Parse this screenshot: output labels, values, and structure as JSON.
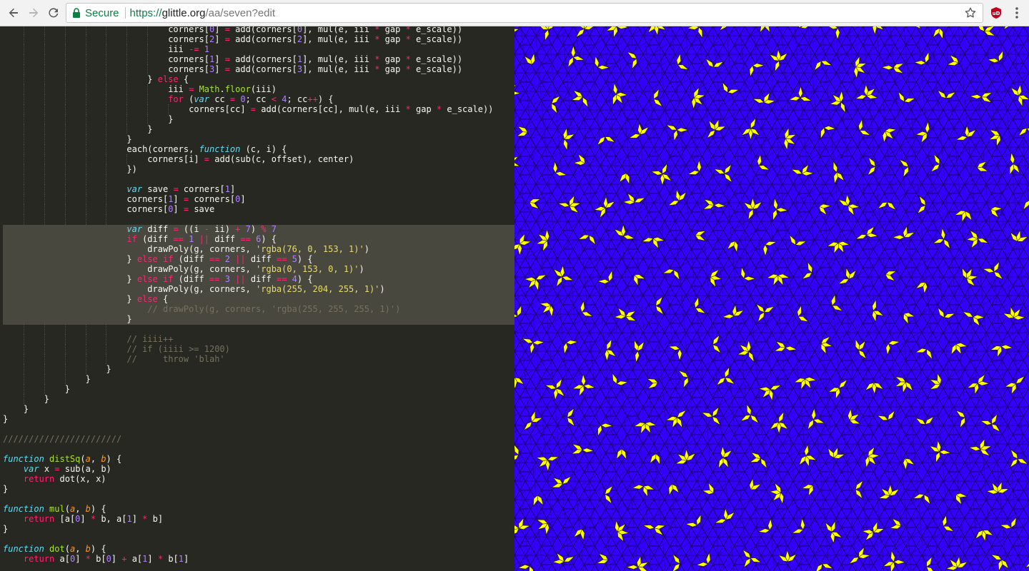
{
  "browser": {
    "secure_label": "Secure",
    "url_scheme": "https://",
    "url_host": "glittle.org",
    "url_path": "/aa/seven?edit",
    "extension_badge": "uD",
    "icons": [
      "back-icon",
      "forward-icon",
      "reload-icon",
      "lock-icon",
      "star-icon",
      "extension-icon",
      "menu-icon"
    ]
  },
  "colors": {
    "editor_bg": "#272822",
    "highlight_bg": "#49483e",
    "canvas_blue": "#3300ff",
    "canvas_yellow": "#ffff00",
    "secure_green": "#0b8043"
  },
  "editor": {
    "lines": [
      [
        [
          32,
          ""
        ],
        [
          "p",
          "corners["
        ],
        [
          "n",
          "0"
        ],
        [
          "p",
          "] "
        ],
        [
          "k",
          "="
        ],
        [
          "p",
          " add(corners["
        ],
        [
          "n",
          "0"
        ],
        [
          "p",
          "], mul(e, iii "
        ],
        [
          "k",
          "*"
        ],
        [
          "p",
          " gap "
        ],
        [
          "k",
          "*"
        ],
        [
          "p",
          " e_scale))"
        ]
      ],
      [
        [
          32,
          ""
        ],
        [
          "p",
          "corners["
        ],
        [
          "n",
          "2"
        ],
        [
          "p",
          "] "
        ],
        [
          "k",
          "="
        ],
        [
          "p",
          " add(corners["
        ],
        [
          "n",
          "2"
        ],
        [
          "p",
          "], mul(e, iii "
        ],
        [
          "k",
          "*"
        ],
        [
          "p",
          " gap "
        ],
        [
          "k",
          "*"
        ],
        [
          "p",
          " e_scale))"
        ]
      ],
      [
        [
          32,
          ""
        ],
        [
          "p",
          "iii "
        ],
        [
          "k",
          "-="
        ],
        [
          "p",
          " "
        ],
        [
          "n",
          "1"
        ]
      ],
      [
        [
          32,
          ""
        ],
        [
          "p",
          "corners["
        ],
        [
          "n",
          "1"
        ],
        [
          "p",
          "] "
        ],
        [
          "k",
          "="
        ],
        [
          "p",
          " add(corners["
        ],
        [
          "n",
          "1"
        ],
        [
          "p",
          "], mul(e, iii "
        ],
        [
          "k",
          "*"
        ],
        [
          "p",
          " gap "
        ],
        [
          "k",
          "*"
        ],
        [
          "p",
          " e_scale))"
        ]
      ],
      [
        [
          32,
          ""
        ],
        [
          "p",
          "corners["
        ],
        [
          "n",
          "3"
        ],
        [
          "p",
          "] "
        ],
        [
          "k",
          "="
        ],
        [
          "p",
          " add(corners["
        ],
        [
          "n",
          "3"
        ],
        [
          "p",
          "], mul(e, iii "
        ],
        [
          "k",
          "*"
        ],
        [
          "p",
          " gap "
        ],
        [
          "k",
          "*"
        ],
        [
          "p",
          " e_scale))"
        ]
      ],
      [
        [
          28,
          ""
        ],
        [
          "p",
          "} "
        ],
        [
          "k",
          "else"
        ],
        [
          "p",
          " {"
        ]
      ],
      [
        [
          32,
          ""
        ],
        [
          "p",
          "iii "
        ],
        [
          "k",
          "="
        ],
        [
          "p",
          " "
        ],
        [
          "b",
          "Math"
        ],
        [
          "p",
          "."
        ],
        [
          "f",
          "floor"
        ],
        [
          "p",
          "(iii)"
        ]
      ],
      [
        [
          32,
          ""
        ],
        [
          "k",
          "for"
        ],
        [
          "p",
          " ("
        ],
        [
          "s",
          "var"
        ],
        [
          "p",
          " cc "
        ],
        [
          "k",
          "="
        ],
        [
          "p",
          " "
        ],
        [
          "n",
          "0"
        ],
        [
          "p",
          "; cc "
        ],
        [
          "k",
          "<"
        ],
        [
          "p",
          " "
        ],
        [
          "n",
          "4"
        ],
        [
          "p",
          "; cc"
        ],
        [
          "k",
          "++"
        ],
        [
          "p",
          ") {"
        ]
      ],
      [
        [
          36,
          ""
        ],
        [
          "p",
          "corners[cc] "
        ],
        [
          "k",
          "="
        ],
        [
          "p",
          " add(corners[cc], mul(e, iii "
        ],
        [
          "k",
          "*"
        ],
        [
          "p",
          " gap "
        ],
        [
          "k",
          "*"
        ],
        [
          "p",
          " e_scale))"
        ]
      ],
      [
        [
          32,
          ""
        ],
        [
          "p",
          "}"
        ]
      ],
      [
        [
          28,
          ""
        ],
        [
          "p",
          "}"
        ]
      ],
      [
        [
          24,
          ""
        ],
        [
          "p",
          "}"
        ]
      ],
      [
        [
          24,
          ""
        ],
        [
          "p",
          "each(corners, "
        ],
        [
          "s",
          "function"
        ],
        [
          "p",
          " (c, i) {"
        ]
      ],
      [
        [
          28,
          ""
        ],
        [
          "p",
          "corners[i] "
        ],
        [
          "k",
          "="
        ],
        [
          "p",
          " add(sub(c, offset), center)"
        ]
      ],
      [
        [
          24,
          ""
        ],
        [
          "p",
          "})"
        ]
      ],
      [
        [
          24,
          ""
        ]
      ],
      [
        [
          24,
          ""
        ],
        [
          "s",
          "var"
        ],
        [
          "p",
          " save "
        ],
        [
          "k",
          "="
        ],
        [
          "p",
          " corners["
        ],
        [
          "n",
          "1"
        ],
        [
          "p",
          "]"
        ]
      ],
      [
        [
          24,
          ""
        ],
        [
          "p",
          "corners["
        ],
        [
          "n",
          "1"
        ],
        [
          "p",
          "] "
        ],
        [
          "k",
          "="
        ],
        [
          "p",
          " corners["
        ],
        [
          "n",
          "0"
        ],
        [
          "p",
          "]"
        ]
      ],
      [
        [
          24,
          ""
        ],
        [
          "p",
          "corners["
        ],
        [
          "n",
          "0"
        ],
        [
          "p",
          "] "
        ],
        [
          "k",
          "="
        ],
        [
          "p",
          " save"
        ]
      ],
      [
        [
          24,
          ""
        ]
      ],
      [
        [
          24,
          ""
        ],
        [
          "s",
          "var"
        ],
        [
          "p",
          " diff "
        ],
        [
          "k",
          "="
        ],
        [
          "p",
          " ((i "
        ],
        [
          "k",
          "-"
        ],
        [
          "p",
          " ii) "
        ],
        [
          "k",
          "+"
        ],
        [
          "p",
          " "
        ],
        [
          "n",
          "7"
        ],
        [
          "p",
          ") "
        ],
        [
          "k",
          "%"
        ],
        [
          "p",
          " "
        ],
        [
          "n",
          "7"
        ]
      ],
      [
        [
          24,
          ""
        ],
        [
          "k",
          "if"
        ],
        [
          "p",
          " (diff "
        ],
        [
          "k",
          "=="
        ],
        [
          "p",
          " "
        ],
        [
          "n",
          "1"
        ],
        [
          "p",
          " "
        ],
        [
          "k",
          "||"
        ],
        [
          "p",
          " diff "
        ],
        [
          "k",
          "=="
        ],
        [
          "p",
          " "
        ],
        [
          "n",
          "6"
        ],
        [
          "p",
          ") {"
        ]
      ],
      [
        [
          28,
          ""
        ],
        [
          "p",
          "drawPoly(g, corners, "
        ],
        [
          "t",
          "'rgba(76, 0, 153, 1)'"
        ],
        [
          "p",
          ")"
        ]
      ],
      [
        [
          24,
          ""
        ],
        [
          "p",
          "} "
        ],
        [
          "k",
          "else"
        ],
        [
          "p",
          " "
        ],
        [
          "k",
          "if"
        ],
        [
          "p",
          " (diff "
        ],
        [
          "k",
          "=="
        ],
        [
          "p",
          " "
        ],
        [
          "n",
          "2"
        ],
        [
          "p",
          " "
        ],
        [
          "k",
          "||"
        ],
        [
          "p",
          " diff "
        ],
        [
          "k",
          "=="
        ],
        [
          "p",
          " "
        ],
        [
          "n",
          "5"
        ],
        [
          "p",
          ") {"
        ]
      ],
      [
        [
          28,
          ""
        ],
        [
          "p",
          "drawPoly(g, corners, "
        ],
        [
          "t",
          "'rgba(0, 153, 0, 1)'"
        ],
        [
          "p",
          ")"
        ]
      ],
      [
        [
          24,
          ""
        ],
        [
          "p",
          "} "
        ],
        [
          "k",
          "else"
        ],
        [
          "p",
          " "
        ],
        [
          "k",
          "if"
        ],
        [
          "p",
          " (diff "
        ],
        [
          "k",
          "=="
        ],
        [
          "p",
          " "
        ],
        [
          "n",
          "3"
        ],
        [
          "p",
          " "
        ],
        [
          "k",
          "||"
        ],
        [
          "p",
          " diff "
        ],
        [
          "k",
          "=="
        ],
        [
          "p",
          " "
        ],
        [
          "n",
          "4"
        ],
        [
          "p",
          ") {"
        ]
      ],
      [
        [
          28,
          ""
        ],
        [
          "p",
          "drawPoly(g, corners, "
        ],
        [
          "t",
          "'rgba(255, 204, 255, 1)'"
        ],
        [
          "p",
          ")"
        ]
      ],
      [
        [
          24,
          ""
        ],
        [
          "p",
          "} "
        ],
        [
          "k",
          "else"
        ],
        [
          "p",
          " {"
        ]
      ],
      [
        [
          28,
          ""
        ],
        [
          "c",
          "// drawPoly(g, corners, 'rgba(255, 255, 255, 1)')"
        ]
      ],
      [
        [
          24,
          ""
        ],
        [
          "p",
          "}"
        ]
      ],
      [
        [
          24,
          ""
        ]
      ],
      [
        [
          24,
          ""
        ],
        [
          "c",
          "// iiii++"
        ]
      ],
      [
        [
          24,
          ""
        ],
        [
          "c",
          "// if (iiii >= 1200)"
        ]
      ],
      [
        [
          24,
          ""
        ],
        [
          "c",
          "//     throw 'blah'"
        ]
      ],
      [
        [
          20,
          ""
        ],
        [
          "p",
          "}"
        ]
      ],
      [
        [
          16,
          ""
        ],
        [
          "p",
          "}"
        ]
      ],
      [
        [
          12,
          ""
        ],
        [
          "p",
          "}"
        ]
      ],
      [
        [
          8,
          ""
        ],
        [
          "p",
          "}"
        ]
      ],
      [
        [
          4,
          ""
        ],
        [
          "p",
          "}"
        ]
      ],
      [
        [
          0,
          ""
        ],
        [
          "p",
          "}"
        ]
      ],
      [
        [
          0,
          ""
        ]
      ],
      [
        [
          0,
          ""
        ],
        [
          "c",
          "///////////////////////"
        ]
      ],
      [
        [
          0,
          ""
        ]
      ],
      [
        [
          0,
          ""
        ],
        [
          "s",
          "function"
        ],
        [
          "p",
          " "
        ],
        [
          "f",
          "distSq"
        ],
        [
          "p",
          "("
        ],
        [
          "a",
          "a"
        ],
        [
          "p",
          ", "
        ],
        [
          "a",
          "b"
        ],
        [
          "p",
          ") {"
        ]
      ],
      [
        [
          4,
          ""
        ],
        [
          "s",
          "var"
        ],
        [
          "p",
          " x "
        ],
        [
          "k",
          "="
        ],
        [
          "p",
          " sub(a, b)"
        ]
      ],
      [
        [
          4,
          ""
        ],
        [
          "k",
          "return"
        ],
        [
          "p",
          " dot(x, x)"
        ]
      ],
      [
        [
          0,
          ""
        ],
        [
          "p",
          "}"
        ]
      ],
      [
        [
          0,
          ""
        ]
      ],
      [
        [
          0,
          ""
        ],
        [
          "s",
          "function"
        ],
        [
          "p",
          " "
        ],
        [
          "f",
          "mul"
        ],
        [
          "p",
          "("
        ],
        [
          "a",
          "a"
        ],
        [
          "p",
          ", "
        ],
        [
          "a",
          "b"
        ],
        [
          "p",
          ") {"
        ]
      ],
      [
        [
          4,
          ""
        ],
        [
          "k",
          "return"
        ],
        [
          "p",
          " [a["
        ],
        [
          "n",
          "0"
        ],
        [
          "p",
          "] "
        ],
        [
          "k",
          "*"
        ],
        [
          "p",
          " b, a["
        ],
        [
          "n",
          "1"
        ],
        [
          "p",
          "] "
        ],
        [
          "k",
          "*"
        ],
        [
          "p",
          " b]"
        ]
      ],
      [
        [
          0,
          ""
        ],
        [
          "p",
          "}"
        ]
      ],
      [
        [
          0,
          ""
        ]
      ],
      [
        [
          0,
          ""
        ],
        [
          "s",
          "function"
        ],
        [
          "p",
          " "
        ],
        [
          "f",
          "dot"
        ],
        [
          "p",
          "("
        ],
        [
          "a",
          "a"
        ],
        [
          "p",
          ", "
        ],
        [
          "a",
          "b"
        ],
        [
          "p",
          ") {"
        ]
      ],
      [
        [
          4,
          ""
        ],
        [
          "k",
          "return"
        ],
        [
          "p",
          " a["
        ],
        [
          "n",
          "0"
        ],
        [
          "p",
          "] "
        ],
        [
          "k",
          "*"
        ],
        [
          "p",
          " b["
        ],
        [
          "n",
          "0"
        ],
        [
          "p",
          "] "
        ],
        [
          "k",
          "+"
        ],
        [
          "p",
          " a["
        ],
        [
          "n",
          "1"
        ],
        [
          "p",
          "] "
        ],
        [
          "k",
          "*"
        ],
        [
          "p",
          " b["
        ],
        [
          "n",
          "1"
        ],
        [
          "p",
          "]"
        ]
      ]
    ]
  }
}
